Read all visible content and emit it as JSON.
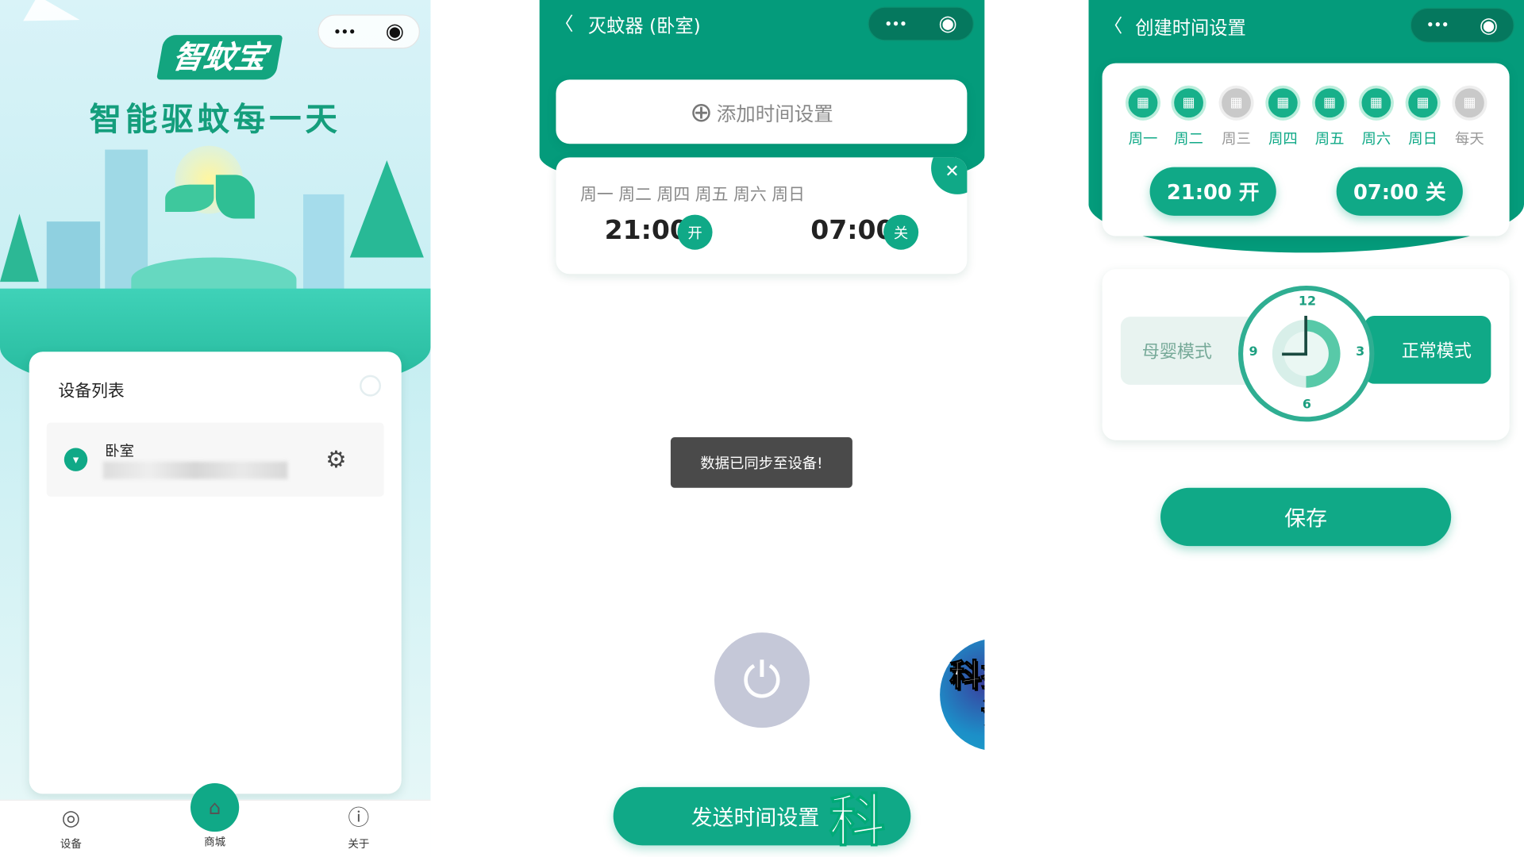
{
  "colors": {
    "brand": "#10a987",
    "header": "#049b7b",
    "power_disabled": "#c5c8d8",
    "toast": "#4a4a4a"
  },
  "screen1": {
    "logo": "智蚊宝",
    "slogan": "智能驱蚊每一天",
    "capsule": {
      "more": "•••",
      "close": "◉"
    },
    "device_list_title": "设备列表",
    "devices": [
      {
        "name": "卧室",
        "icon": "device-icon"
      }
    ],
    "tabs": [
      {
        "label": "设备",
        "icon": "device-icon"
      },
      {
        "label": "商城",
        "icon": "store-icon"
      },
      {
        "label": "关于",
        "icon": "info-icon"
      }
    ]
  },
  "screen2": {
    "back": "〈",
    "title": "灭蚊器 (卧室)",
    "capsule": {
      "more": "•••",
      "close": "◉"
    },
    "add_button": "添加时间设置",
    "add_icon": "⊕",
    "schedule": {
      "days": "周一 周二 周四 周五 周六 周日",
      "on_time": "21:00",
      "on_label": "开",
      "off_time": "07:00",
      "off_label": "关",
      "close": "✕"
    },
    "toast": "数据已同步至设备!",
    "power_icon": "⏻",
    "send_button": "发送时间设置",
    "watermark": "科技探谈",
    "watermark_partial": "科"
  },
  "screen3": {
    "back": "〈",
    "title": "创建时间设置",
    "capsule": {
      "more": "•••",
      "close": "◉"
    },
    "days": [
      {
        "label": "周一",
        "selected": true
      },
      {
        "label": "周二",
        "selected": true
      },
      {
        "label": "周三",
        "selected": false
      },
      {
        "label": "周四",
        "selected": true
      },
      {
        "label": "周五",
        "selected": true
      },
      {
        "label": "周六",
        "selected": true
      },
      {
        "label": "周日",
        "selected": true
      },
      {
        "label": "每天",
        "selected": false
      }
    ],
    "on_button": "21:00 开",
    "off_button": "07:00 关",
    "mode_left": "母婴模式",
    "mode_right": "正常模式",
    "clock": {
      "n12": "12",
      "n3": "3",
      "n6": "6",
      "n9": "9"
    },
    "save": "保存"
  }
}
